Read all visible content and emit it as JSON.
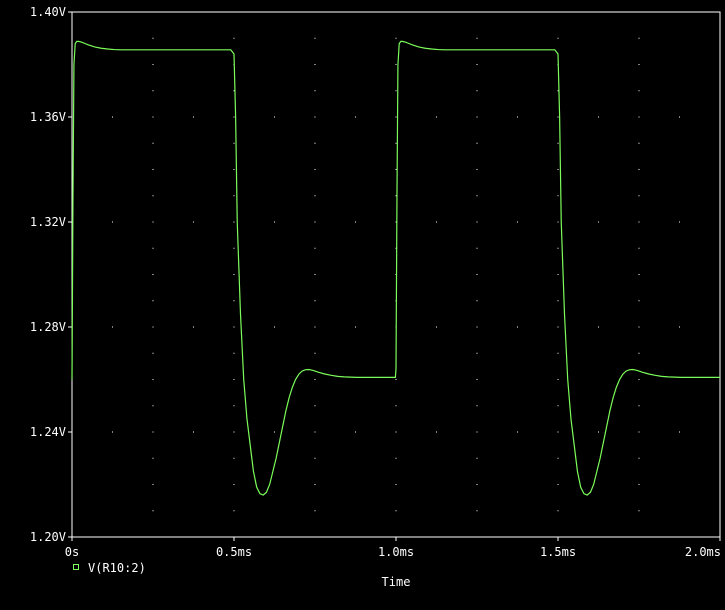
{
  "chart_data": {
    "type": "line",
    "xlabel": "Time",
    "ylabel": "",
    "xlim": [
      0,
      2.0
    ],
    "ylim": [
      1.2,
      1.4
    ],
    "x_unit": "ms",
    "y_unit": "V",
    "x_ticks": [
      {
        "value": 0,
        "label": "0s"
      },
      {
        "value": 0.5,
        "label": "0.5ms"
      },
      {
        "value": 1.0,
        "label": "1.0ms"
      },
      {
        "value": 1.5,
        "label": "1.5ms"
      },
      {
        "value": 2.0,
        "label": "2.0ms"
      }
    ],
    "y_ticks": [
      {
        "value": 1.2,
        "label": "1.20V"
      },
      {
        "value": 1.24,
        "label": "1.24V"
      },
      {
        "value": 1.28,
        "label": "1.28V"
      },
      {
        "value": 1.32,
        "label": "1.32V"
      },
      {
        "value": 1.36,
        "label": "1.36V"
      },
      {
        "value": 1.4,
        "label": "1.40V"
      }
    ],
    "grid": true,
    "legend_position": "bottom-left",
    "colors": {
      "background": "#000000",
      "frame": "#ffffff",
      "grid": "#ffffff",
      "text": "#ffffff",
      "trace": "#7cfc5a"
    },
    "series": [
      {
        "name": "V(R10:2)",
        "x": [
          0.0,
          0.003,
          0.006,
          0.01,
          0.015,
          0.02,
          0.03,
          0.04,
          0.05,
          0.07,
          0.09,
          0.11,
          0.13,
          0.15,
          0.2,
          0.3,
          0.4,
          0.49,
          0.5,
          0.505,
          0.51,
          0.52,
          0.53,
          0.54,
          0.55,
          0.56,
          0.57,
          0.58,
          0.59,
          0.6,
          0.61,
          0.62,
          0.63,
          0.64,
          0.65,
          0.66,
          0.67,
          0.68,
          0.69,
          0.7,
          0.71,
          0.72,
          0.73,
          0.74,
          0.75,
          0.76,
          0.78,
          0.8,
          0.82,
          0.84,
          0.86,
          0.88,
          0.9,
          0.95,
          0.99,
          0.998,
          1.0,
          1.003,
          1.006,
          1.01,
          1.015,
          1.02,
          1.03,
          1.04,
          1.05,
          1.07,
          1.09,
          1.11,
          1.13,
          1.15,
          1.2,
          1.3,
          1.4,
          1.49,
          1.5,
          1.505,
          1.51,
          1.52,
          1.53,
          1.54,
          1.55,
          1.56,
          1.57,
          1.58,
          1.59,
          1.6,
          1.61,
          1.62,
          1.63,
          1.64,
          1.65,
          1.66,
          1.67,
          1.68,
          1.69,
          1.7,
          1.71,
          1.72,
          1.73,
          1.74,
          1.75,
          1.76,
          1.78,
          1.8,
          1.82,
          1.84,
          1.86,
          1.88,
          1.9,
          1.95,
          2.0
        ],
        "values": [
          1.26,
          1.33,
          1.38,
          1.388,
          1.3888,
          1.3888,
          1.3885,
          1.388,
          1.3875,
          1.3867,
          1.3862,
          1.3859,
          1.3857,
          1.3856,
          1.3856,
          1.3856,
          1.3856,
          1.3856,
          1.384,
          1.36,
          1.32,
          1.285,
          1.26,
          1.245,
          1.235,
          1.225,
          1.219,
          1.2165,
          1.216,
          1.217,
          1.22,
          1.225,
          1.23,
          1.236,
          1.242,
          1.248,
          1.253,
          1.257,
          1.26,
          1.262,
          1.2632,
          1.2637,
          1.2638,
          1.2636,
          1.2632,
          1.2628,
          1.2621,
          1.2616,
          1.2612,
          1.261,
          1.2609,
          1.2608,
          1.2608,
          1.2608,
          1.2608,
          1.2608,
          1.264,
          1.33,
          1.38,
          1.388,
          1.3888,
          1.3888,
          1.3885,
          1.388,
          1.3875,
          1.3867,
          1.3862,
          1.3859,
          1.3857,
          1.3856,
          1.3856,
          1.3856,
          1.3856,
          1.3856,
          1.384,
          1.36,
          1.32,
          1.285,
          1.26,
          1.245,
          1.235,
          1.225,
          1.219,
          1.2165,
          1.216,
          1.217,
          1.22,
          1.225,
          1.23,
          1.236,
          1.242,
          1.248,
          1.253,
          1.257,
          1.26,
          1.262,
          1.2632,
          1.2637,
          1.2638,
          1.2636,
          1.2632,
          1.2628,
          1.2621,
          1.2616,
          1.2612,
          1.261,
          1.2609,
          1.2608,
          1.2608,
          1.2608,
          1.2608
        ]
      }
    ]
  }
}
